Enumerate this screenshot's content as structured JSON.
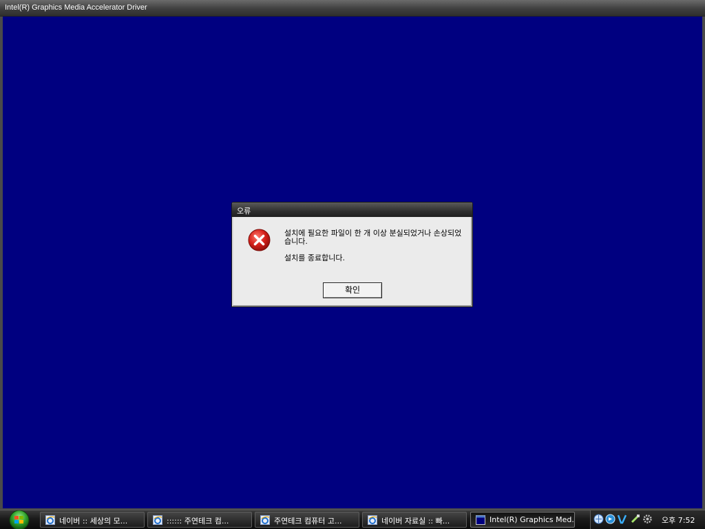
{
  "window": {
    "title": "Intel(R) Graphics Media Accelerator Driver"
  },
  "dialog": {
    "title": "오류",
    "icon": "error-icon",
    "message_line1": "설치에 필요한 파일이 한 개 이상 분실되었거나 손상되었습니다.",
    "message_line2": "설치를 종료합니다.",
    "ok_label": "확인"
  },
  "taskbar": {
    "start_icon": "windows-start-icon",
    "items": [
      {
        "label": "네이버 :: 세상의 모...",
        "icon": "internet-explorer-icon",
        "active": false
      },
      {
        "label": ":::::: 주연테크 컴...",
        "icon": "internet-explorer-icon",
        "active": false
      },
      {
        "label": "주연테크 컴퓨터 고...",
        "icon": "internet-explorer-icon",
        "active": false
      },
      {
        "label": "네이버 자료실 :: 빠...",
        "icon": "internet-explorer-icon",
        "active": false
      },
      {
        "label": "Intel(R) Graphics Med...",
        "icon": "installer-window-icon",
        "active": true
      }
    ],
    "tray_icons": [
      "network-icon",
      "audio-icon",
      "v3-antivirus-icon",
      "usb-device-icon",
      "settings-icon"
    ],
    "clock": "오후 7:52"
  },
  "colors": {
    "client_background": "#000080",
    "dialog_background": "#ebebeb",
    "error_red": "#d4201a"
  }
}
